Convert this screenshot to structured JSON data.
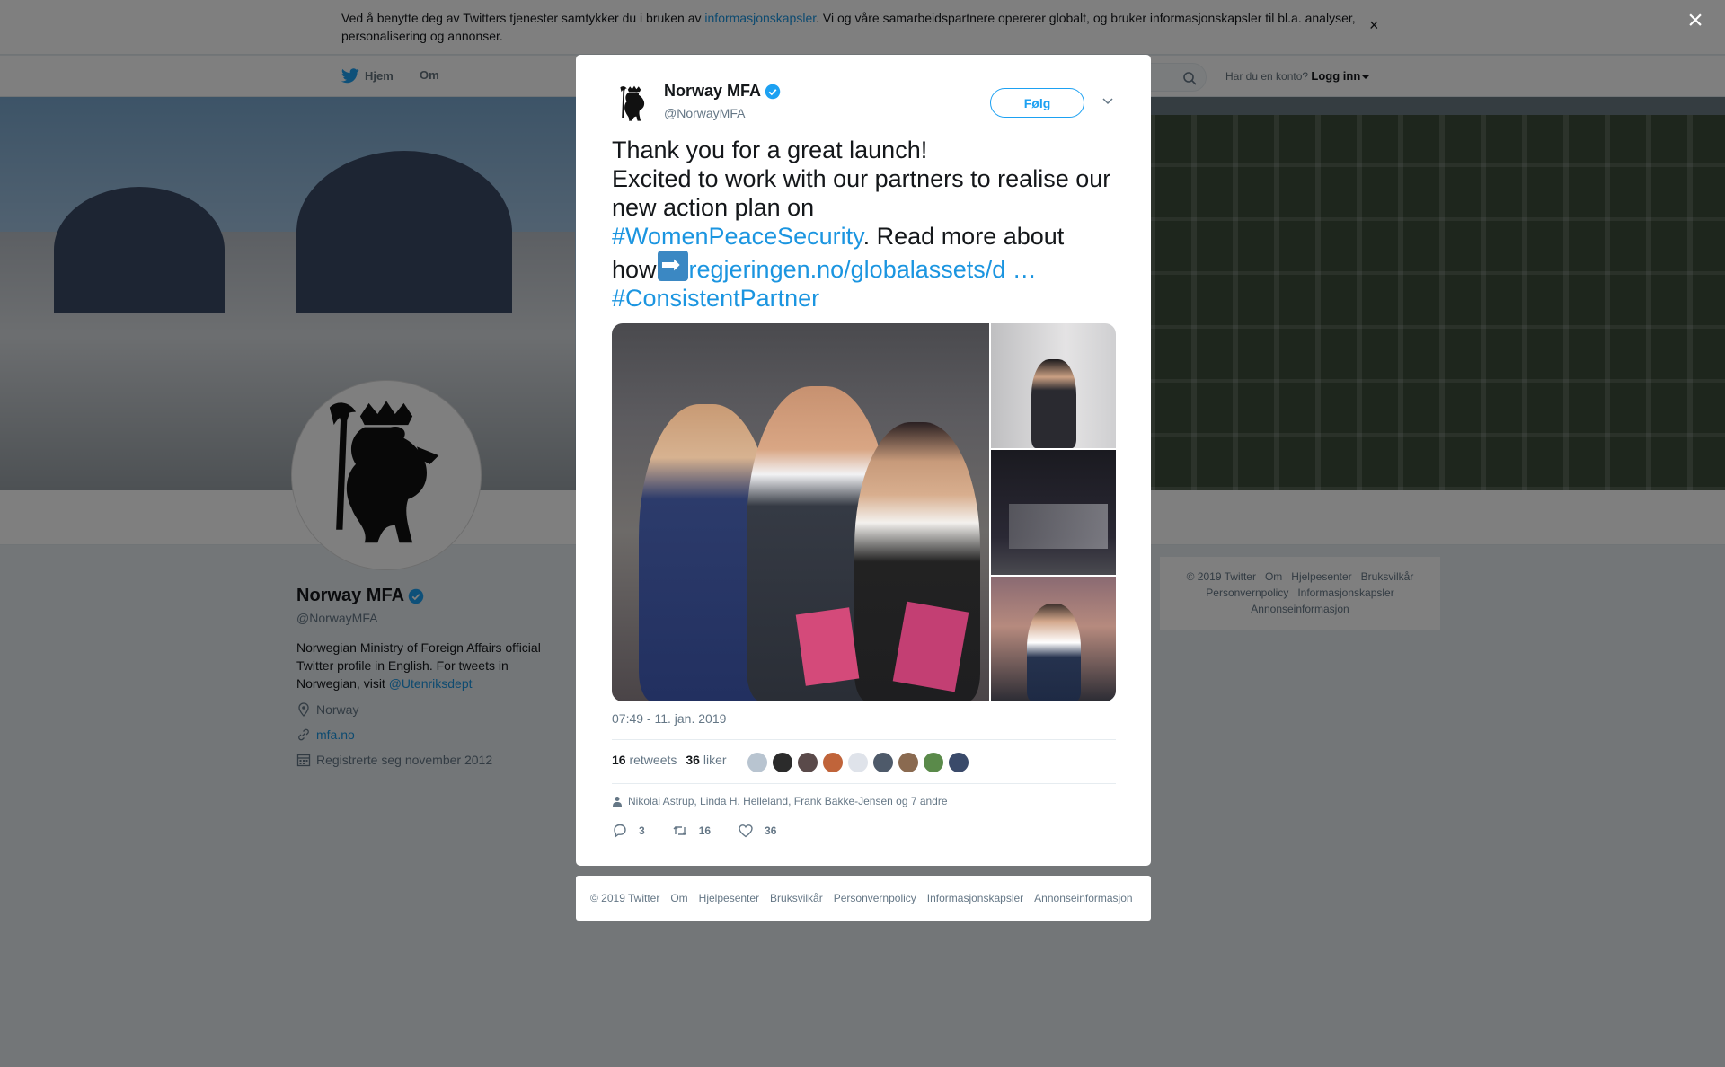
{
  "cookie": {
    "text_before": "Ved å benytte deg av Twitters tjenester samtykker du i bruken av ",
    "link": "informasjonskapsler",
    "text_after": ". Vi og våre samarbeidspartnere opererer globalt, og bruker informasjonskapsler til bl.a. analyser, personalisering og annonser.",
    "close": "×"
  },
  "nav": {
    "home": "Hjem",
    "about": "Om",
    "login_prompt": "Har du en konto?",
    "login": "Logg inn"
  },
  "profile": {
    "name": "Norway MFA",
    "handle": "@NorwayMFA",
    "bio_text": "Norwegian Ministry of Foreign Affairs official Twitter profile in English. For tweets in Norwegian, visit ",
    "bio_link": "@Utenriksdept",
    "location": "Norway",
    "website": "mfa.no",
    "joined": "Registrerte seg november 2012"
  },
  "side_footer": {
    "row1": [
      "© 2019 Twitter",
      "Om",
      "Hjelpesenter",
      "Bruksvilkår"
    ],
    "row2": [
      "Personvernpolicy",
      "Informasjonskapsler"
    ],
    "row3": [
      "Annonseinformasjon"
    ]
  },
  "overlay_close": "×",
  "tweet": {
    "name": "Norway MFA",
    "handle": "@NorwayMFA",
    "follow": "Følg",
    "line1": "Thank you for a great launch!",
    "line2": "Excited to work with our partners to realise our new action plan on",
    "hashtag1": "#WomenPeaceSecurity",
    "line3": ". Read more about how",
    "link": "regjeringen.no/globalassets/d",
    "ellipsis": " …",
    "hashtag2": "#ConsistentPartner",
    "timestamp": "07:49 - 11. jan. 2019",
    "retweets_count": "16",
    "retweets_label": "retweets",
    "likes_count": "36",
    "likes_label": "liker",
    "liked_by": "Nikolai Astrup, Linda H. Helleland, Frank Bakke-Jensen og 7 andre",
    "reply_count": "3",
    "retweet_count": "16",
    "like_count": "36",
    "liker_colors": [
      "#b8c4d0",
      "#2b2b2b",
      "#5a4a4a",
      "#c0643a",
      "#dfe3ea",
      "#4e5a6a",
      "#8a6a50",
      "#5a8a4a",
      "#3a4a6a"
    ]
  },
  "modal_footer": [
    "© 2019 Twitter",
    "Om",
    "Hjelpesenter",
    "Bruksvilkår",
    "Personvernpolicy",
    "Informasjonskapsler",
    "Annonseinformasjon"
  ]
}
